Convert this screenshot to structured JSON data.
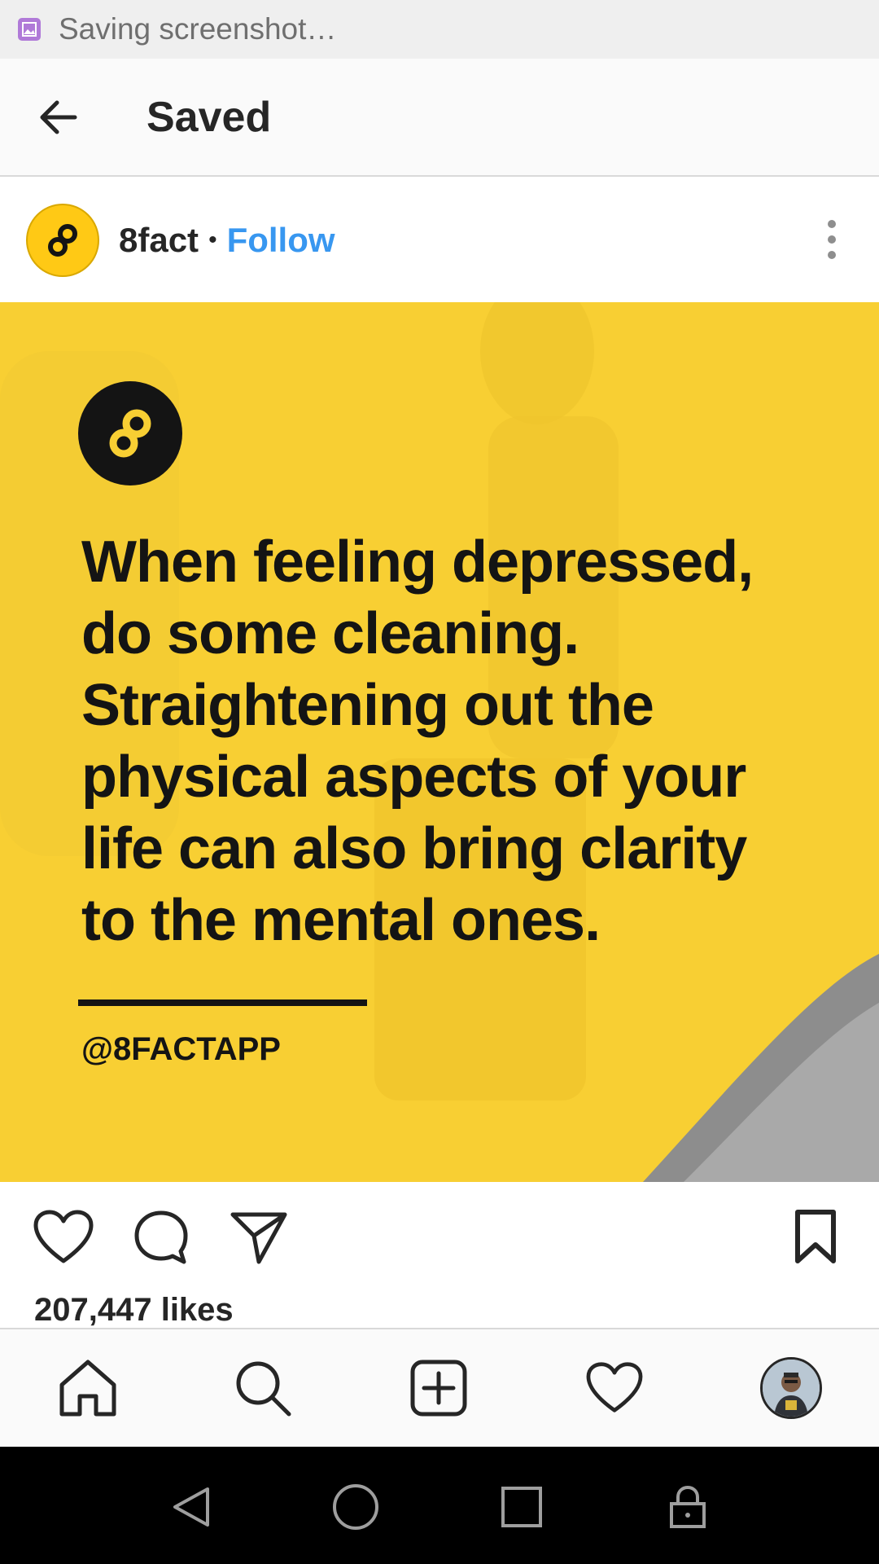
{
  "status_bar": {
    "notification_icon": "gallery-icon",
    "text": "Saving screenshot…"
  },
  "app_bar": {
    "back_icon": "arrow-left-icon",
    "title": "Saved"
  },
  "post": {
    "username": "8fact",
    "separator": "•",
    "follow_label": "Follow",
    "more_icon": "more-vertical-icon",
    "image": {
      "background_color": "#f8cf33",
      "quote": "When feeling depressed, do some cleaning. Straightening out the physical aspects of your life can also bring clarity to the mental ones.",
      "handle": "@8FACTAPP"
    },
    "actions": {
      "like_icon": "heart-icon",
      "comment_icon": "comment-icon",
      "share_icon": "send-icon",
      "save_icon": "bookmark-icon"
    },
    "likes": "207,447 likes"
  },
  "bottom_nav": {
    "items": [
      "home-icon",
      "search-icon",
      "new-post-icon",
      "activity-icon",
      "profile-avatar"
    ]
  },
  "system_nav": {
    "items": [
      "back-icon",
      "home-icon",
      "recents-icon",
      "lock-icon"
    ]
  },
  "colors": {
    "brand_yellow": "#ffc915",
    "link_blue": "#3897f0",
    "text_dark": "#262626"
  }
}
